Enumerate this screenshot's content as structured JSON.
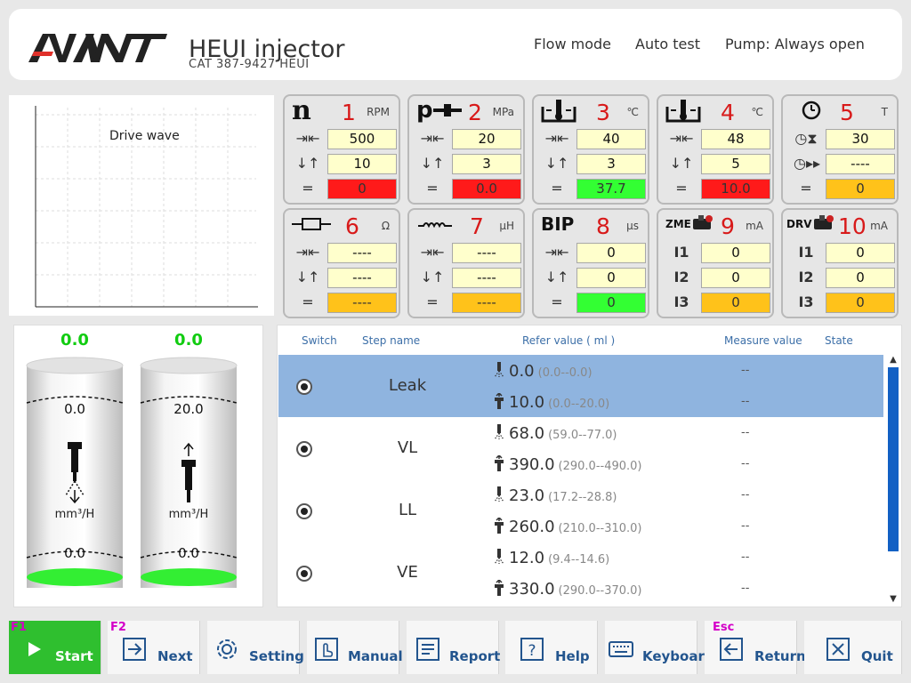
{
  "header": {
    "logo_text": "AVANT",
    "title": "HEUI injector",
    "subtitle": "CAT   387-9427  HEUI",
    "links": [
      "Flow mode",
      "Auto test",
      "Pump: Always open"
    ]
  },
  "chart": {
    "title": "Drive wave"
  },
  "cards": [
    {
      "sym": "n",
      "num": "1",
      "unit": "RPM",
      "r1": "500",
      "r2": "10",
      "r3": "0",
      "status": "red"
    },
    {
      "sym": "p",
      "num": "2",
      "unit": "MPa",
      "r1": "20",
      "r2": "3",
      "r3": "0.0",
      "status": "red"
    },
    {
      "sym": "",
      "num": "3",
      "unit": "℃",
      "r1": "40",
      "r2": "3",
      "r3": "37.7",
      "status": "green"
    },
    {
      "sym": "",
      "num": "4",
      "unit": "℃",
      "r1": "48",
      "r2": "5",
      "r3": "10.0",
      "status": "red"
    },
    {
      "sym": "",
      "num": "5",
      "unit": "T",
      "r1": "30",
      "r2": "----",
      "r3": "0",
      "status": "orange"
    },
    {
      "sym": "",
      "num": "6",
      "unit": "Ω",
      "r1": "----",
      "r2": "----",
      "r3": "----",
      "status": "orange"
    },
    {
      "sym": "",
      "num": "7",
      "unit": "μH",
      "r1": "----",
      "r2": "----",
      "r3": "----",
      "status": "orange"
    },
    {
      "sym": "BIP",
      "num": "8",
      "unit": "μs",
      "r1": "0",
      "r2": "0",
      "r3": "0",
      "status": "green"
    },
    {
      "sym": "ZME",
      "num": "9",
      "unit": "mA",
      "r1": "0",
      "r2": "0",
      "r3": "0",
      "status": "orange"
    },
    {
      "sym": "DRV",
      "num": "10",
      "unit": "mA",
      "r1": "0",
      "r2": "0",
      "r3": "0",
      "status": "orange"
    }
  ],
  "row_labels": {
    "eq": "=",
    "i1": "I1",
    "i2": "I2",
    "i3": "I3"
  },
  "cylinders": [
    {
      "top": "0.0",
      "upper": "0.0",
      "lower": "0.0",
      "unit": "mm³/H",
      "direction": "down"
    },
    {
      "top": "0.0",
      "upper": "20.0",
      "lower": "0.0",
      "unit": "mm³/H",
      "direction": "up"
    }
  ],
  "table": {
    "headers": [
      "Switch",
      "Step name",
      "Refer value ( ml )",
      "Measure value",
      "State"
    ],
    "rows": [
      {
        "name": "Leak",
        "selected": true,
        "v1": "0.0",
        "r1": "(0.0--0.0)",
        "m1": "--",
        "v2": "10.0",
        "r2": "(0.0--20.0)",
        "m2": "--"
      },
      {
        "name": "VL",
        "selected": false,
        "v1": "68.0",
        "r1": "(59.0--77.0)",
        "m1": "--",
        "v2": "390.0",
        "r2": "(290.0--490.0)",
        "m2": "--"
      },
      {
        "name": "LL",
        "selected": false,
        "v1": "23.0",
        "r1": "(17.2--28.8)",
        "m1": "--",
        "v2": "260.0",
        "r2": "(210.0--310.0)",
        "m2": "--"
      },
      {
        "name": "VE",
        "selected": false,
        "v1": "12.0",
        "r1": "(9.4--14.6)",
        "m1": "--",
        "v2": "330.0",
        "r2": "(290.0--370.0)",
        "m2": "--"
      }
    ]
  },
  "footer": {
    "keys": {
      "f1": "F1",
      "f2": "F2",
      "esc": "Esc"
    },
    "buttons": [
      "Start",
      "Next",
      "Setting",
      "Manual",
      "Report",
      "Help",
      "Keyboard",
      "Return",
      "Quit"
    ]
  },
  "colors": {
    "accent_red": "#d81a1a",
    "status_green": "#33ff33",
    "status_red": "#ff1a1a",
    "status_orange": "#ffc21a",
    "selected_row": "#8fb4df",
    "button_text": "#23558e",
    "start_green": "#2fbf2f"
  }
}
